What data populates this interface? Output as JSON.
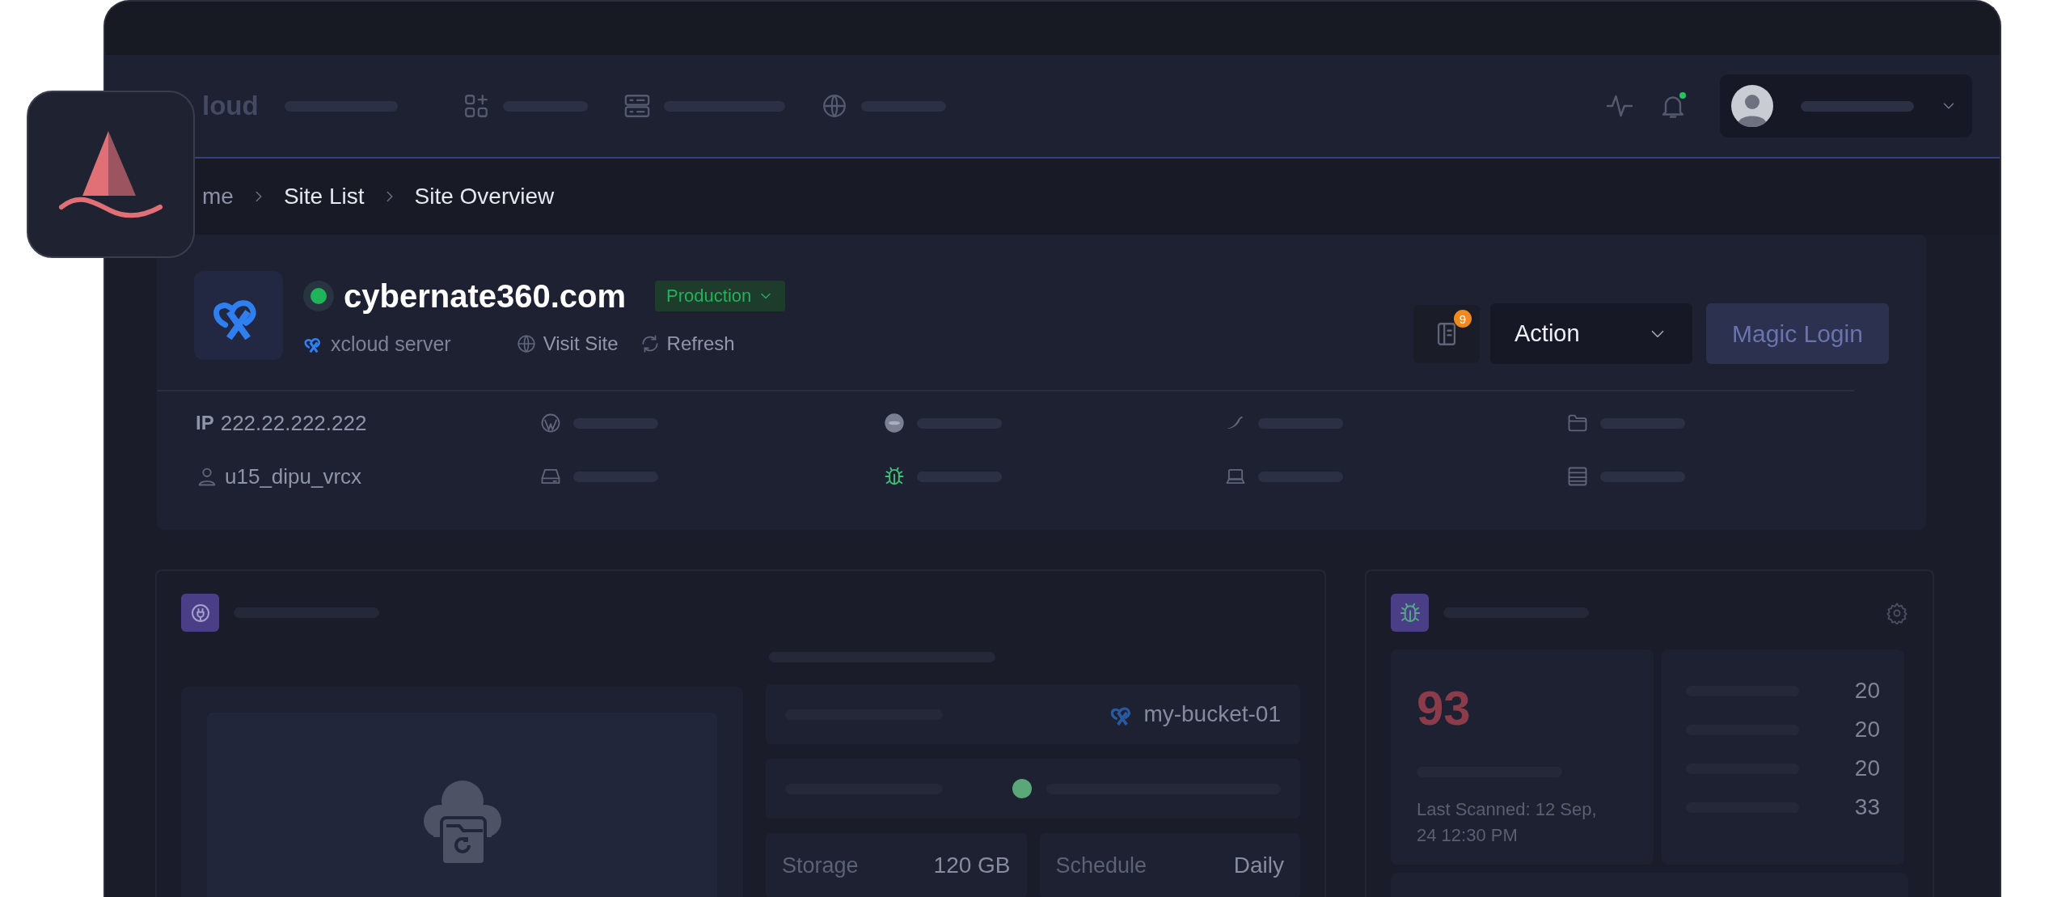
{
  "nav": {
    "brand": "loud",
    "notifications_unread": true
  },
  "breadcrumb": [
    {
      "label": "me"
    },
    {
      "label": "Site List"
    },
    {
      "label": "Site Overview"
    }
  ],
  "site": {
    "online": true,
    "name": "cybernate360.com",
    "environment": "Production",
    "server": "xcloud server",
    "links": [
      {
        "label": "Visit Site",
        "kind": "globe"
      },
      {
        "label": "Refresh",
        "kind": "refresh"
      }
    ],
    "notes_count": "9",
    "action": "Action",
    "magic_login": "Magic Login",
    "ip_label": "IP",
    "ip": "222.22.222.222",
    "user": "u15_dipu_vrcx"
  },
  "backup": {
    "bucket": "my-bucket-01",
    "stats": [
      {
        "label": "Storage",
        "value": "120 GB"
      },
      {
        "label": "Schedule",
        "value": "Daily"
      }
    ]
  },
  "security": {
    "score": "93",
    "last_scanned": "Last Scanned: 12 Sep, 24 12:30 PM",
    "counts": [
      "20",
      "20",
      "20",
      "33"
    ]
  }
}
